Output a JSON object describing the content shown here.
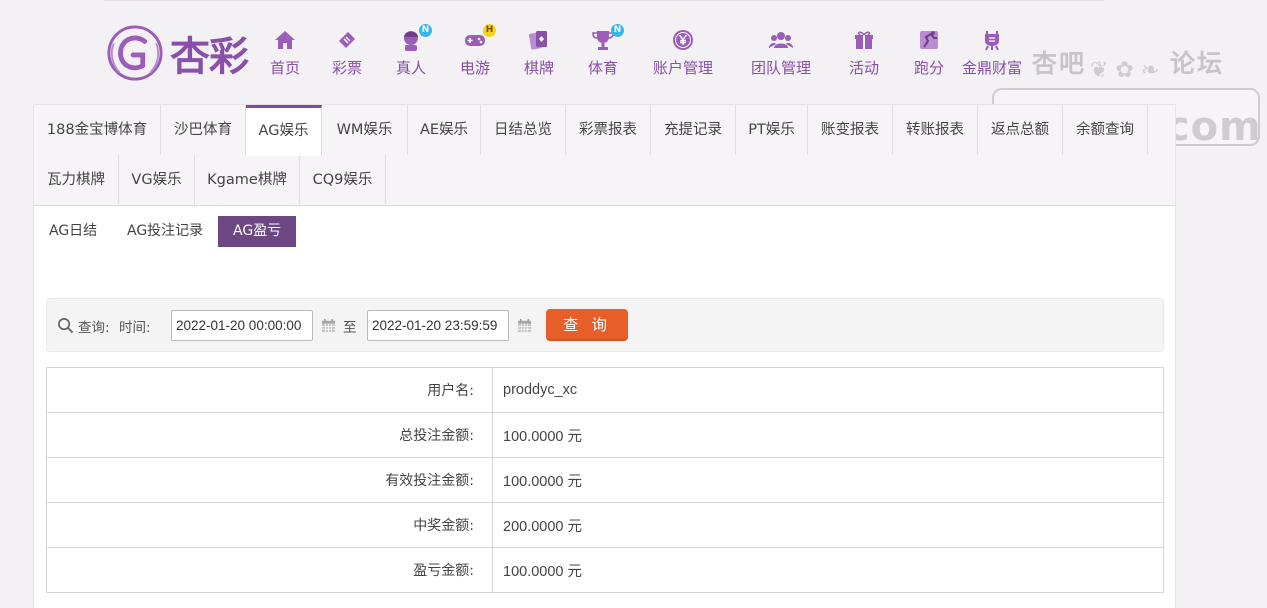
{
  "brand": {
    "logo_text": "杏彩",
    "accent": "#8a4fa8",
    "active_tab_color": "#7a4b96",
    "subtab_active_color": "#6c4784",
    "button_color": "#e85e28"
  },
  "nav": [
    {
      "label": "首页",
      "icon": "home-icon"
    },
    {
      "label": "彩票",
      "icon": "lottery-ticket-icon"
    },
    {
      "label": "真人",
      "icon": "dealer-icon",
      "badge": "N"
    },
    {
      "label": "电游",
      "icon": "gamepad-icon",
      "badge": "H"
    },
    {
      "label": "棋牌",
      "icon": "cards-icon"
    },
    {
      "label": "体育",
      "icon": "trophy-icon",
      "badge": "N"
    },
    {
      "label": "账户管理",
      "icon": "yuan-coin-icon"
    },
    {
      "label": "团队管理",
      "icon": "team-icon"
    },
    {
      "label": "活动",
      "icon": "gift-icon"
    },
    {
      "label": "跑分",
      "icon": "running-icon"
    },
    {
      "label": "金鼎财富",
      "icon": "tripod-icon"
    }
  ],
  "watermark": {
    "top_left": "杏吧",
    "top_right": "论坛",
    "main": "网家50.com"
  },
  "tabs": [
    "188金宝博体育",
    "沙巴体育",
    "AG娱乐",
    "WM娱乐",
    "AE娱乐",
    "日结总览",
    "彩票报表",
    "充提记录",
    "PT娱乐",
    "账变报表",
    "转账报表",
    "返点总额",
    "余额查询",
    "瓦力棋牌",
    "VG娱乐",
    "Kgame棋牌",
    "CQ9娱乐"
  ],
  "active_tab": "AG娱乐",
  "subtabs": [
    "AG日结",
    "AG投注记录",
    "AG盈亏"
  ],
  "active_subtab": "AG盈亏",
  "search": {
    "query_label": "查询:",
    "time_label": "时间:",
    "start": "2022-01-20 00:00:00",
    "to_label": "至",
    "end": "2022-01-20 23:59:59",
    "button": "查 询"
  },
  "rows": [
    {
      "label": "用户名:",
      "value": "proddyc_xc"
    },
    {
      "label": "总投注金额:",
      "value": "100.0000 元"
    },
    {
      "label": "有效投注金额:",
      "value": "100.0000 元"
    },
    {
      "label": "中奖金额:",
      "value": "200.0000 元"
    },
    {
      "label": "盈亏金额:",
      "value": "100.0000 元"
    }
  ]
}
